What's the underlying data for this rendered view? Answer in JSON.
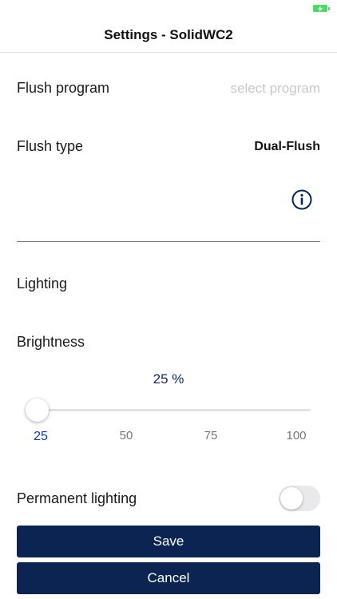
{
  "nav": {
    "title": "Settings - SolidWC2"
  },
  "flush_program": {
    "label": "Flush program",
    "placeholder": "select program"
  },
  "flush_type": {
    "label": "Flush type",
    "value": "Dual-Flush"
  },
  "icons": {
    "info": "info-icon",
    "battery": "battery-charging-icon"
  },
  "lighting": {
    "label": "Lighting"
  },
  "brightness": {
    "label": "Brightness",
    "value_text": "25 %",
    "value": 25,
    "ticks": [
      "25",
      "50",
      "75",
      "100"
    ],
    "selected_tick": "25"
  },
  "permanent_lighting": {
    "label": "Permanent lighting",
    "enabled": false
  },
  "buttons": {
    "save": "Save",
    "cancel": "Cancel"
  },
  "colors": {
    "primary": "#0b2452",
    "accent": "#0b3fa8",
    "battery": "#4cd964"
  }
}
